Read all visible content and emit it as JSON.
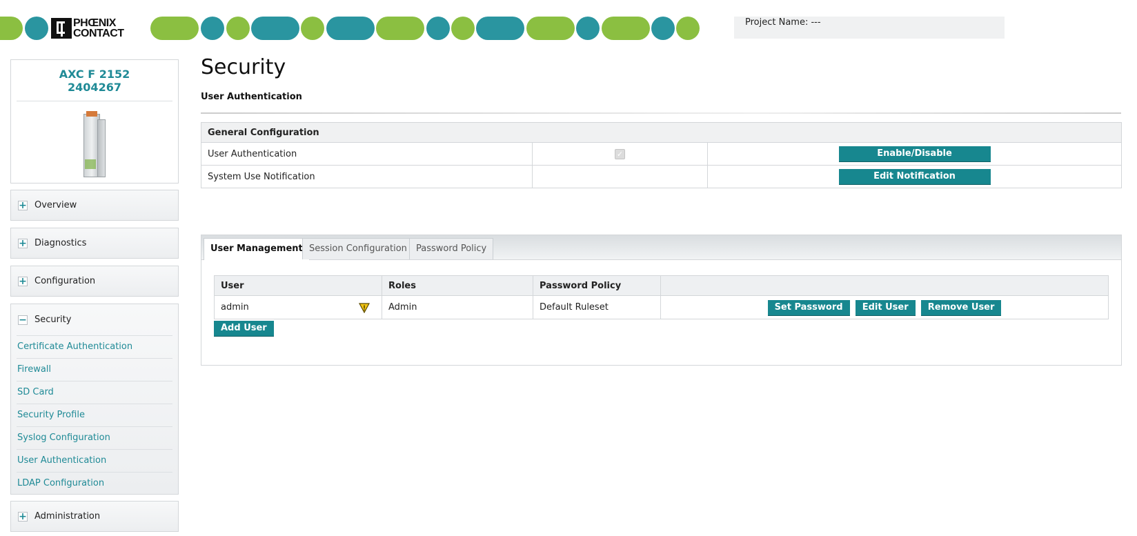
{
  "header": {
    "brand": [
      "PHŒNIX",
      "CONTACT"
    ],
    "project_label": "Project Name: ---"
  },
  "device": {
    "model": "AXC F 2152",
    "order_number": "2404267"
  },
  "sidebar": {
    "items": [
      {
        "label": "Overview",
        "expander": "+"
      },
      {
        "label": "Diagnostics",
        "expander": "+"
      },
      {
        "label": "Configuration",
        "expander": "+"
      }
    ],
    "security": {
      "label": "Security",
      "expander": "−",
      "subitems": [
        "Certificate Authentication",
        "Firewall",
        "SD Card",
        "Security Profile",
        "Syslog Configuration",
        "User Authentication",
        "LDAP Configuration"
      ]
    },
    "administration": {
      "label": "Administration",
      "expander": "+"
    }
  },
  "page": {
    "title": "Security",
    "subtitle": "User Authentication"
  },
  "general_config": {
    "heading": "General Configuration",
    "rows": [
      {
        "label": "User Authentication",
        "checked": true,
        "button": "Enable/Disable"
      },
      {
        "label": "System Use Notification",
        "button": "Edit Notification"
      }
    ]
  },
  "tabs": [
    "User Management",
    "Session Configuration",
    "Password Policy"
  ],
  "user_table": {
    "columns": [
      "User",
      "Roles",
      "Password Policy",
      ""
    ],
    "rows": [
      {
        "user": "admin",
        "roles": "Admin",
        "policy": "Default Ruleset",
        "warning_icon": "warning-triangle-icon",
        "actions": [
          "Set Password",
          "Edit User",
          "Remove User"
        ]
      }
    ],
    "add_button": "Add User"
  },
  "colors": {
    "accent": "#17878f",
    "teal": "#2a95a0",
    "green": "#8bbf41",
    "link": "#1f8a96"
  }
}
